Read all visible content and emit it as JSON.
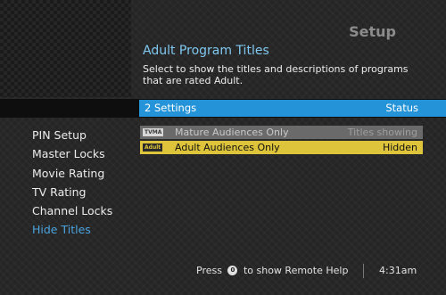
{
  "header": {
    "screen_title": "Setup"
  },
  "content": {
    "title": "Adult Program Titles",
    "description": "Select to show the titles and descriptions of programs that are rated Adult."
  },
  "settings_header": {
    "label": "2  Settings",
    "status_label": "Status"
  },
  "settings_rows": [
    {
      "badge": "TVMA",
      "name": "Mature Audiences Only",
      "status": "Titles showing"
    },
    {
      "badge": "Adult",
      "name": "Adult Audiences Only",
      "status": "Hidden"
    }
  ],
  "side_menu": {
    "items": [
      {
        "label": "PIN Setup"
      },
      {
        "label": "Master Locks"
      },
      {
        "label": "Movie Rating"
      },
      {
        "label": "TV Rating"
      },
      {
        "label": "Channel Locks"
      },
      {
        "label": "Hide Titles"
      }
    ]
  },
  "footer": {
    "help_prefix": "Press",
    "help_button": "0",
    "help_suffix": "to show Remote Help",
    "clock": "4:31am"
  },
  "colors": {
    "accent": "#2493d8",
    "selected_row": "#ddc43a",
    "active_menu": "#4aa3df",
    "title": "#7fc8f0"
  }
}
